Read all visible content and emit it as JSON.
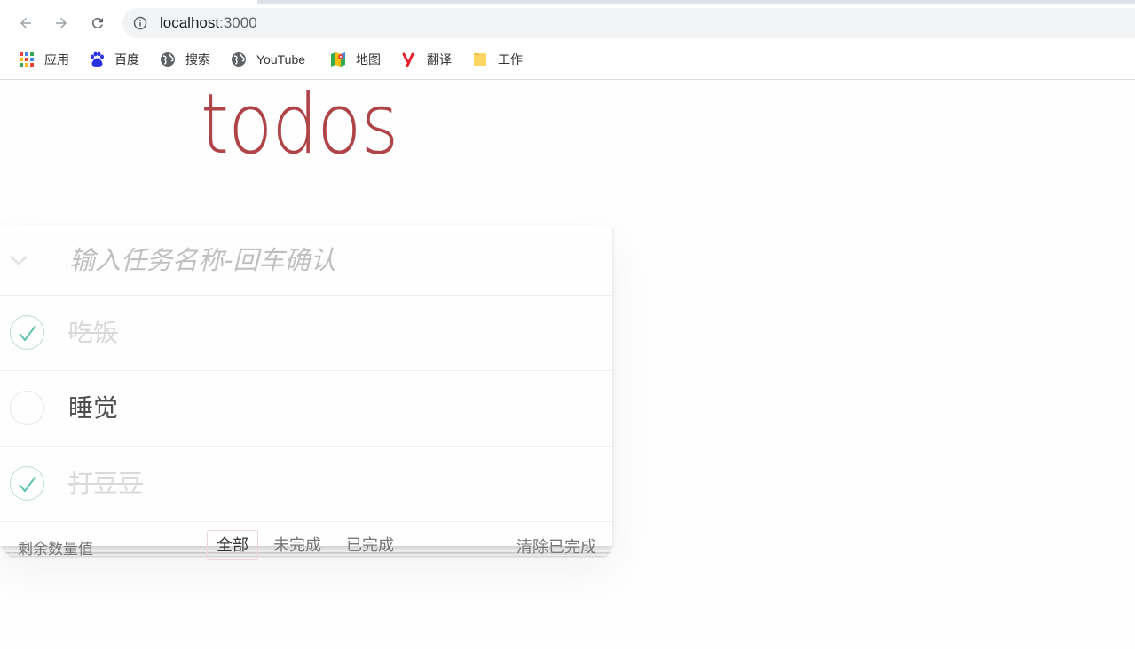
{
  "browser": {
    "url_host": "localhost",
    "url_port": ":3000",
    "bookmarks": [
      {
        "label": "应用",
        "icon": "apps-grid-icon"
      },
      {
        "label": "百度",
        "icon": "baidu-paw-icon"
      },
      {
        "label": "搜索",
        "icon": "globe-icon"
      },
      {
        "label": "YouTube",
        "icon": "globe-icon"
      },
      {
        "label": "地图",
        "icon": "maps-icon"
      },
      {
        "label": "翻译",
        "icon": "youdao-icon"
      },
      {
        "label": "工作",
        "icon": "folder-icon"
      }
    ]
  },
  "app": {
    "title": "todos",
    "new_todo_placeholder": "输入任务名称-回车确认",
    "todos": [
      {
        "label": "吃饭",
        "completed": true
      },
      {
        "label": "睡觉",
        "completed": false
      },
      {
        "label": "打豆豆",
        "completed": true
      }
    ],
    "footer": {
      "count_text": "剩余数量值",
      "filters": [
        {
          "label": "全部",
          "selected": true
        },
        {
          "label": "未完成",
          "selected": false
        },
        {
          "label": "已完成",
          "selected": false
        }
      ],
      "clear_completed": "清除已完成"
    }
  },
  "colors": {
    "title": "#af4448",
    "check": "#5dc2af"
  }
}
